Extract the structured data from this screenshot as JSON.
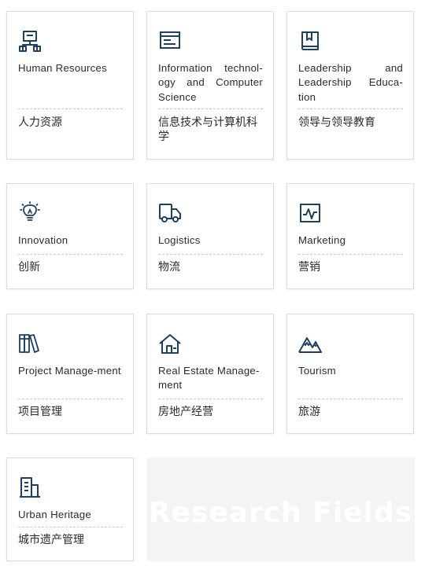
{
  "fields": [
    {
      "icon": "org-chart-icon",
      "en": "Human Resources",
      "zh": "人力资源"
    },
    {
      "icon": "monitor-icon",
      "en": "Information technol-ogy and Computer Science",
      "zh": "信息技术与计算机科学"
    },
    {
      "icon": "book-icon",
      "en": "Leadership and Leadership Educa-tion",
      "zh": "领导与领导教育"
    },
    {
      "icon": "lightbulb-icon",
      "en": "Innovation",
      "zh": "创新"
    },
    {
      "icon": "truck-icon",
      "en": "Logistics",
      "zh": "物流"
    },
    {
      "icon": "chart-pulse-icon",
      "en": "Marketing",
      "zh": "营销"
    },
    {
      "icon": "books-icon",
      "en": "Project Manage-ment",
      "zh": "项目管理"
    },
    {
      "icon": "house-icon",
      "en": "Real Estate Manage-ment",
      "zh": "房地产经营"
    },
    {
      "icon": "mountains-icon",
      "en": "Tourism",
      "zh": "旅游"
    },
    {
      "icon": "building-icon",
      "en": "Urban Heritage",
      "zh": "城市遗产管理"
    }
  ],
  "banner": {
    "title": "Research Fields"
  },
  "colors": {
    "icon": "#1c3f64",
    "text": "#2b2b2b",
    "banner_bg": "#f4f4f4"
  }
}
